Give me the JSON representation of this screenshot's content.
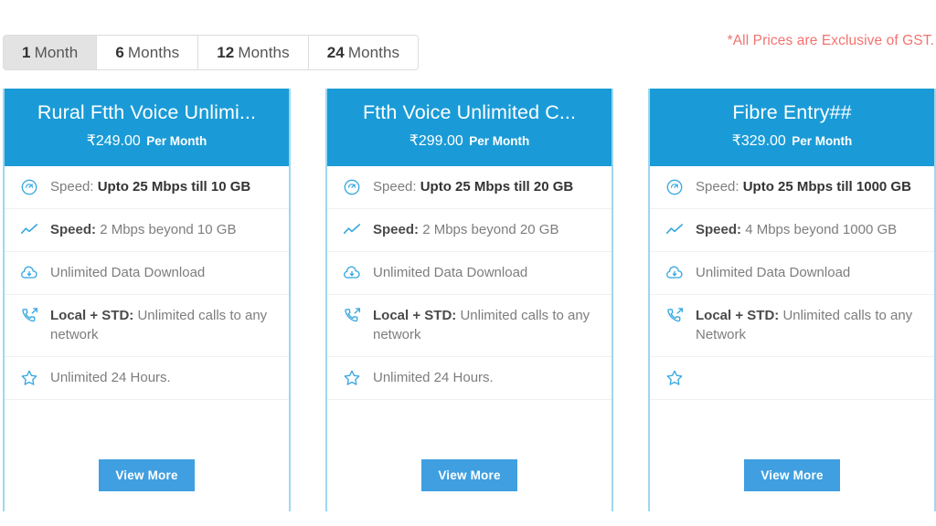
{
  "tabs": [
    {
      "num": "1",
      "unit": "Month",
      "active": true
    },
    {
      "num": "6",
      "unit": "Months",
      "active": false
    },
    {
      "num": "12",
      "unit": "Months",
      "active": false
    },
    {
      "num": "24",
      "unit": "Months",
      "active": false
    }
  ],
  "gst_note": "*All Prices are Exclusive of GST.",
  "colors": {
    "header_blue": "#1a9bd7",
    "button_blue": "#3f9fe0",
    "card_border": "#9ed8ef",
    "icon_blue": "#3aa9e0",
    "gst_red": "#f2736f",
    "active_tab_bg": "#e3e3e3"
  },
  "button_label": "View More",
  "cards": [
    {
      "name": "Rural Ftth Voice Unlimi...",
      "price": "₹249.00",
      "period": "Per Month",
      "features": [
        {
          "icon": "speedometer-icon",
          "label": "Speed:",
          "value": "Upto 25 Mbps till 10 GB",
          "bold_value": true
        },
        {
          "icon": "trend-line-icon",
          "label": "Speed:",
          "value": "2 Mbps beyond 10 GB",
          "bold_value": false
        },
        {
          "icon": "cloud-download-icon",
          "label": "",
          "value": "Unlimited Data Download",
          "bold_value": false
        },
        {
          "icon": "phone-outgoing-icon",
          "label": "Local + STD:",
          "value": "Unlimited calls to any network",
          "bold_value": false
        },
        {
          "icon": "star-icon",
          "label": "",
          "value": "Unlimited 24 Hours.",
          "bold_value": false
        }
      ]
    },
    {
      "name": "Ftth Voice Unlimited C...",
      "price": "₹299.00",
      "period": "Per Month",
      "features": [
        {
          "icon": "speedometer-icon",
          "label": "Speed:",
          "value": "Upto 25 Mbps till 20 GB",
          "bold_value": true
        },
        {
          "icon": "trend-line-icon",
          "label": "Speed:",
          "value": "2 Mbps beyond 20 GB",
          "bold_value": false
        },
        {
          "icon": "cloud-download-icon",
          "label": "",
          "value": "Unlimited Data Download",
          "bold_value": false
        },
        {
          "icon": "phone-outgoing-icon",
          "label": "Local + STD:",
          "value": "Unlimited calls to any network",
          "bold_value": false
        },
        {
          "icon": "star-icon",
          "label": "",
          "value": "Unlimited 24 Hours.",
          "bold_value": false
        }
      ]
    },
    {
      "name": "Fibre Entry##",
      "price": "₹329.00",
      "period": "Per Month",
      "features": [
        {
          "icon": "speedometer-icon",
          "label": "Speed:",
          "value": "Upto 25 Mbps till 1000 GB",
          "bold_value": true
        },
        {
          "icon": "trend-line-icon",
          "label": "Speed:",
          "value": "4 Mbps beyond 1000 GB",
          "bold_value": false
        },
        {
          "icon": "cloud-download-icon",
          "label": "",
          "value": "Unlimited Data Download",
          "bold_value": false
        },
        {
          "icon": "phone-outgoing-icon",
          "label": "Local + STD:",
          "value": "Unlimited calls to any Network",
          "bold_value": false
        },
        {
          "icon": "star-icon",
          "label": "",
          "value": "",
          "bold_value": false
        }
      ]
    }
  ]
}
